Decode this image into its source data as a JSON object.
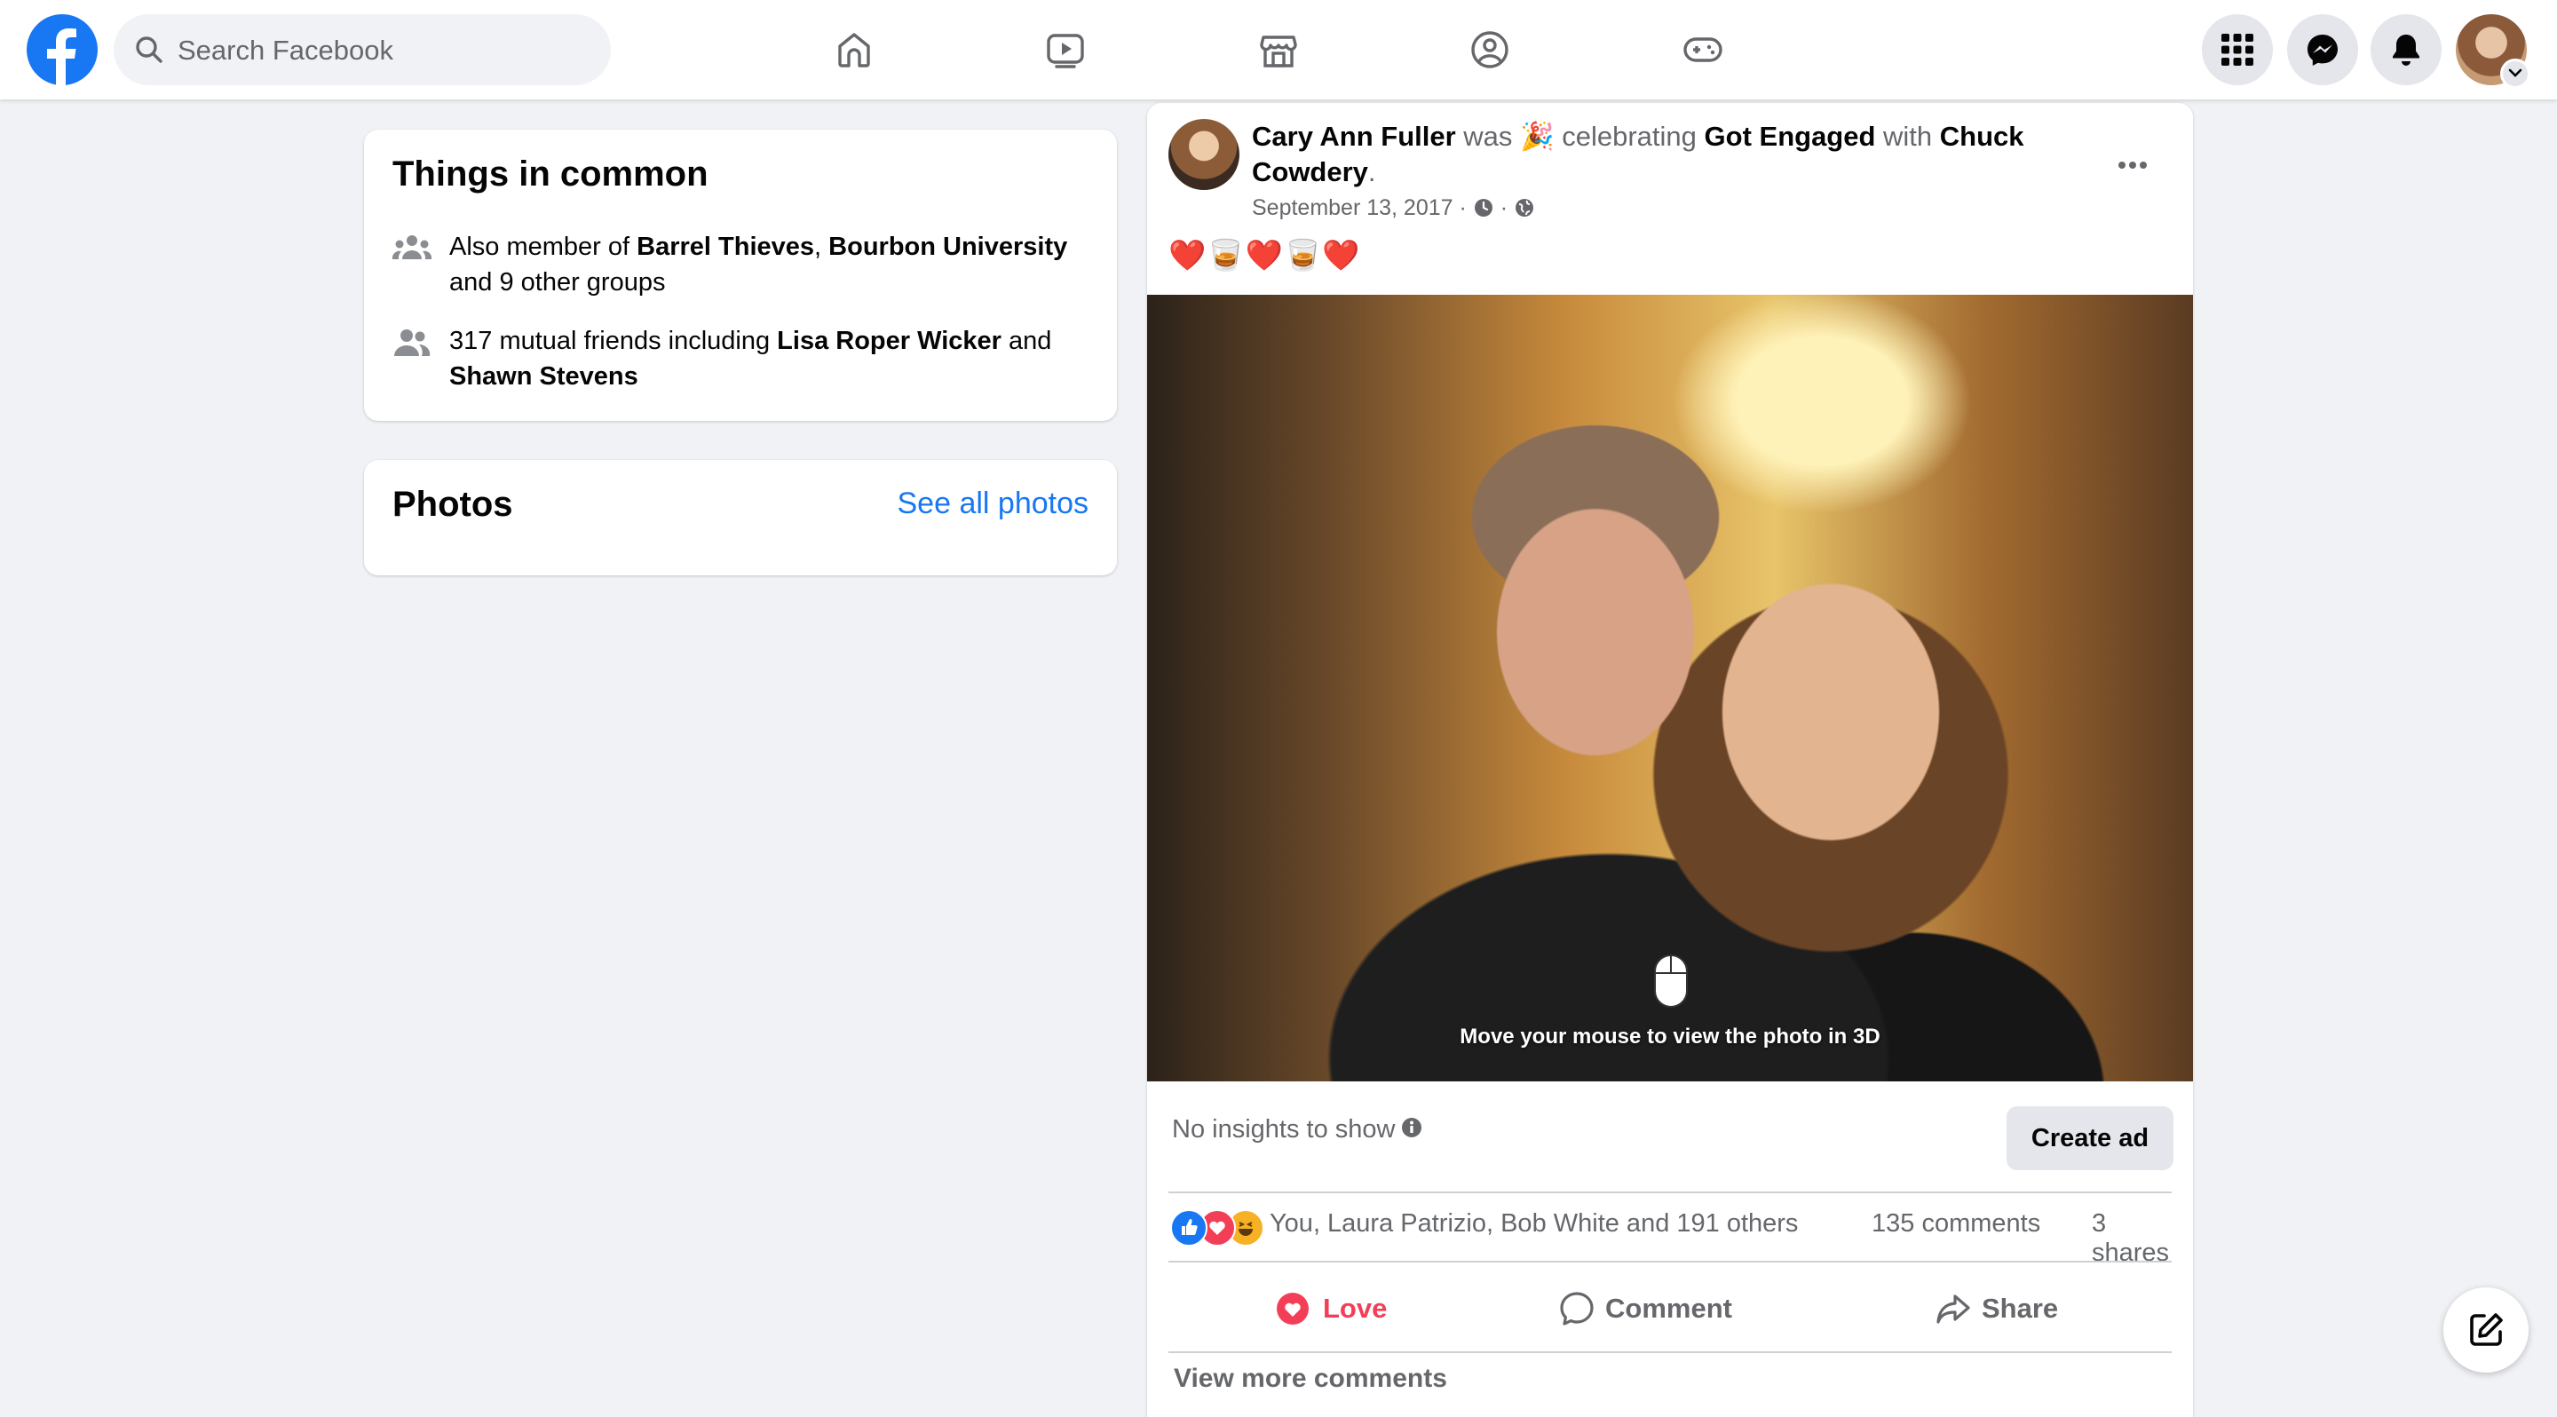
{
  "header": {
    "search_placeholder": "Search Facebook",
    "nav_icons": [
      "home-icon",
      "watch-icon",
      "marketplace-icon",
      "groups-icon",
      "gaming-icon"
    ],
    "right_icons": [
      "menu-grid-icon",
      "messenger-icon",
      "notifications-icon",
      "account-avatar"
    ],
    "brand_color": "#1877f2"
  },
  "things_in_common": {
    "title": "Things in common",
    "groups": {
      "prefix": "Also member of ",
      "group1": "Barrel Thieves",
      "sep": ", ",
      "group2": "Bourbon University",
      "suffix": " and 9 other groups"
    },
    "friends": {
      "prefix": "317 mutual friends including ",
      "friend1": "Lisa Roper Wicker",
      "sep": " and ",
      "friend2": "Shawn Stevens"
    }
  },
  "photos_card": {
    "title": "Photos",
    "see_all": "See all photos"
  },
  "post": {
    "author": "Cary Ann Fuller",
    "was": " was ",
    "emoji": "🎉",
    "celebrating": " celebrating ",
    "event": "Got Engaged",
    "with": " with ",
    "tagged": "Chuck Cowdery",
    "period": ".",
    "date": "September 13, 2017",
    "dot": " · ",
    "text": "❤️🥃❤️🥃❤️",
    "photo_hint": "Move your mouse to view the photo in 3D",
    "insights": "No insights to show",
    "create_ad": "Create ad",
    "reactions_names": "You, Laura Patrizio, Bob White and 191 others",
    "comments_count": "135 comments",
    "shares_count": "3 shares",
    "actions": {
      "love": "Love",
      "comment": "Comment",
      "share": "Share"
    },
    "view_more_comments": "View more comments",
    "love_color": "#f33e58"
  }
}
